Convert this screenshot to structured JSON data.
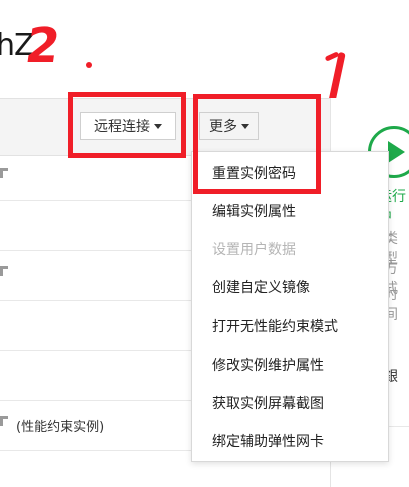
{
  "header": {
    "title_fragment": "hZ"
  },
  "annotations": {
    "number_two": "2",
    "accent": "#f01e28"
  },
  "toolbar": {
    "remote_connect_label": "远程连接",
    "more_label": "更多"
  },
  "instance_rows": {
    "note_text": "(性能约束实例)"
  },
  "right_panel": {
    "status_fragment": "运行中",
    "text1": "类型",
    "text2": "方式",
    "text3": "时间",
    "text4": "銀",
    "status_color": "#1ea94a"
  },
  "more_menu": {
    "items": [
      {
        "label": "重置实例密码",
        "disabled": false
      },
      {
        "label": "编辑实例属性",
        "disabled": false
      },
      {
        "label": "设置用户数据",
        "disabled": true
      },
      {
        "label": "创建自定义镜像",
        "disabled": false
      },
      {
        "label": "打开无性能约束模式",
        "disabled": false
      },
      {
        "label": "修改实例维护属性",
        "disabled": false
      },
      {
        "label": "获取实例屏幕截图",
        "disabled": false
      },
      {
        "label": "绑定辅助弹性网卡",
        "disabled": false
      }
    ]
  }
}
